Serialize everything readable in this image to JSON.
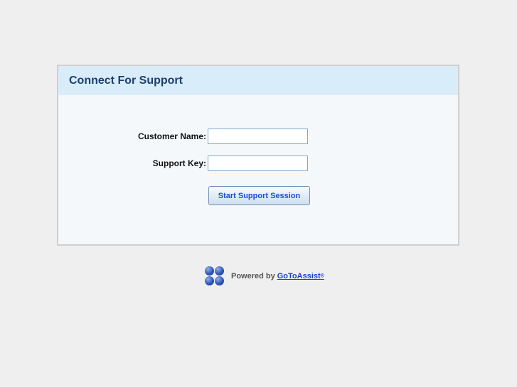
{
  "panel": {
    "title": "Connect For Support"
  },
  "form": {
    "customer_name_label": "Customer Name:",
    "customer_name_value": "",
    "support_key_label": "Support Key:",
    "support_key_value": "",
    "submit_label": "Start Support Session"
  },
  "footer": {
    "powered_by": "Powered by",
    "brand_link": "GoToAssist",
    "reg_mark": "®",
    "logo_icon": "four-blue-circles-logo"
  }
}
